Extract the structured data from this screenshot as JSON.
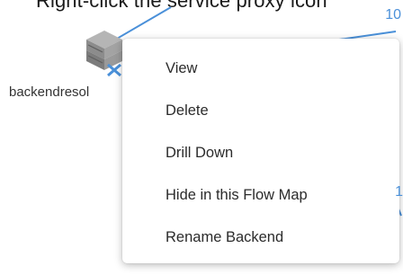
{
  "caption": {
    "text": "Right-click the service proxy icon"
  },
  "flow_map": {
    "edge_label_top": "10",
    "edge_label_right": "1",
    "node": {
      "label": "backendresol",
      "icon": "server-stack-icon"
    }
  },
  "context_menu": {
    "items": [
      {
        "label": "View"
      },
      {
        "label": "Delete"
      },
      {
        "label": "Drill Down"
      },
      {
        "label": "Hide in this Flow Map"
      },
      {
        "label": "Rename Backend"
      }
    ]
  },
  "colors": {
    "flow_line": "#4a90d9",
    "node_icon_gray": "#8c8c8c",
    "menu_text": "#2b2b2b"
  }
}
